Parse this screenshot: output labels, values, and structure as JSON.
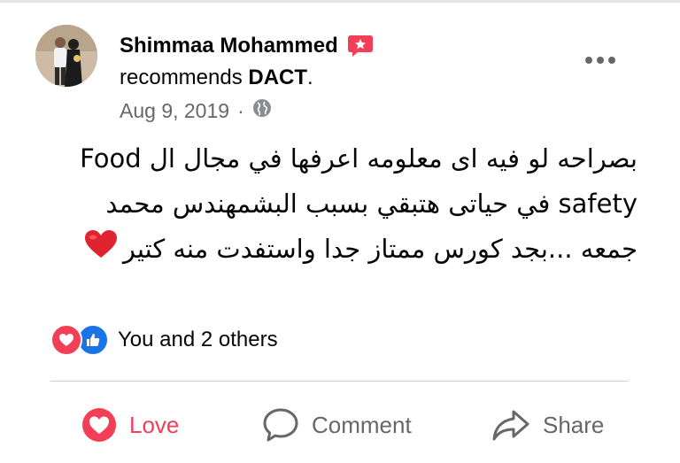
{
  "post": {
    "author": "Shimmaa Mohammed",
    "recommendation_prefix": "recommends",
    "page_name": "DACT",
    "recommendation_suffix": ".",
    "date": "Aug 9, 2019",
    "separator": "·",
    "audience_icon": "globe-icon",
    "badge_icon": "recommend-badge-icon",
    "lines": [
      "بصراحه لو فيه اى معلومه اعرفها في مجال ال Food",
      "safety في حياتى هتبقي بسبب البشمهندس محمد",
      "جمعه ...بجد كورس ممتاز جدا واستفدت منه كتير"
    ],
    "emoji": "red-heart-icon"
  },
  "reactions": {
    "summary": "You and 2 others",
    "icons": [
      "love-reaction-icon",
      "like-reaction-icon"
    ]
  },
  "actions": {
    "love_label": "Love",
    "comment_label": "Comment",
    "share_label": "Share"
  },
  "colors": {
    "love": "#f33e58",
    "like": "#1b74e4",
    "muted": "#65676b",
    "text": "#050505"
  }
}
